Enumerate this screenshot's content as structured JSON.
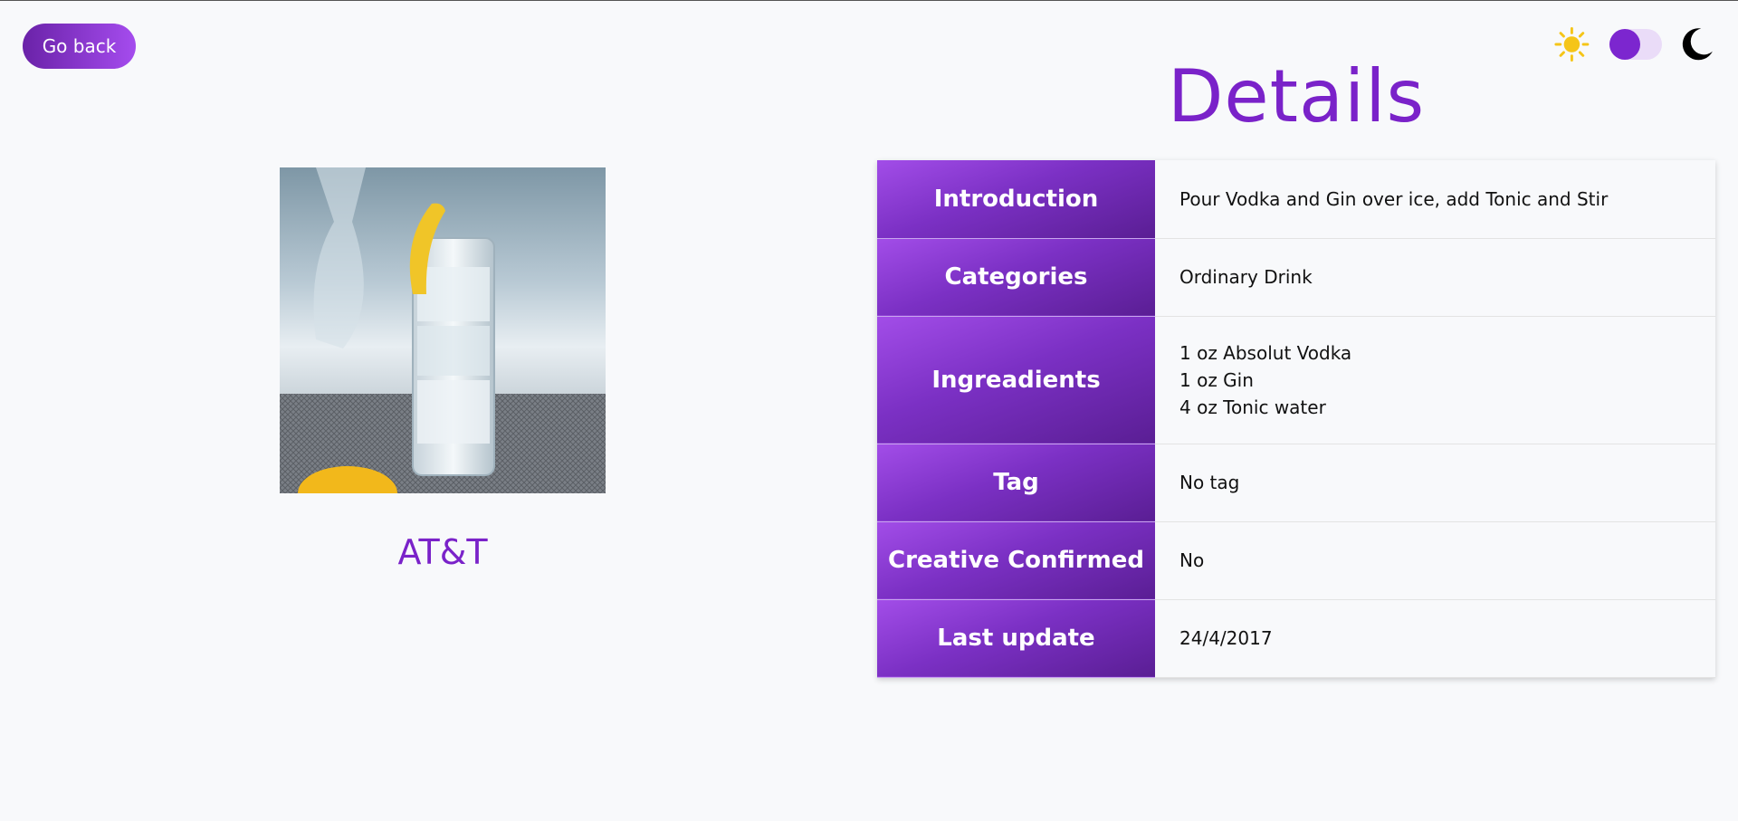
{
  "nav": {
    "back_label": "Go back"
  },
  "theme": {
    "light_icon": "sun-icon",
    "dark_icon": "moon-icon",
    "mode": "light",
    "accent": "#7a22c9"
  },
  "drink": {
    "name": "AT&T",
    "image": "glass of vodka gin tonic with lemon twist"
  },
  "details": {
    "title": "Details",
    "rows": [
      {
        "label": "Introduction",
        "value": "Pour Vodka and Gin over ice, add Tonic and Stir"
      },
      {
        "label": "Categories",
        "value": "Ordinary Drink"
      },
      {
        "label": "Ingreadients",
        "values": [
          "1 oz Absolut Vodka",
          "1 oz Gin",
          "4 oz Tonic water"
        ]
      },
      {
        "label": "Tag",
        "value": "No tag"
      },
      {
        "label": "Creative Confirmed",
        "value": "No"
      },
      {
        "label": "Last update",
        "value": "24/4/2017"
      }
    ]
  }
}
